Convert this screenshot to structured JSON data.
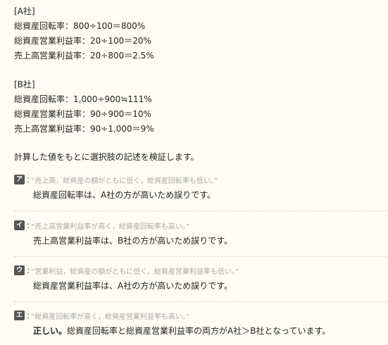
{
  "company_a": {
    "label": "[A社]",
    "lines": [
      "総資産回転率：800÷100＝800%",
      "総資産営業利益率：20÷100＝20%",
      "売上高営業利益率：20÷800＝2.5%"
    ]
  },
  "company_b": {
    "label": "[B社]",
    "lines": [
      "総資産回転率：1,000÷900≒111%",
      "総資産営業利益率：90÷900＝10%",
      "売上高営業利益率：90÷1,000＝9%"
    ]
  },
  "intro": "計算した値をもとに選択肢の記述を検証します。",
  "choices": [
    {
      "badge": "ア",
      "colon": ":",
      "quote": "“売上高，総資産の額がともに低く，総資産回転率も低い。”",
      "answer_strong": "",
      "answer": "総資産回転率は、A社の方が高いため誤りです。"
    },
    {
      "badge": "イ",
      "colon": ":",
      "quote": "“売上高営業利益率が高く，総資産回転率も高い。”",
      "answer_strong": "",
      "answer": "売上高営業利益率は、B社の方が高いため誤りです。"
    },
    {
      "badge": "ウ",
      "colon": ":",
      "quote": "“営業利益，総資産の額がともに低く，総資産営業利益率も低い。”",
      "answer_strong": "",
      "answer": "総資産営業利益率は、A社の方が高いため誤りです。"
    },
    {
      "badge": "エ",
      "colon": ":",
      "quote": "“総資産回転率が高く，総資産営業利益率も高い。”",
      "answer_strong": "正しい。",
      "answer": "総資産回転率と総資産営業利益率の両方がA社＞B社となっています。"
    }
  ]
}
